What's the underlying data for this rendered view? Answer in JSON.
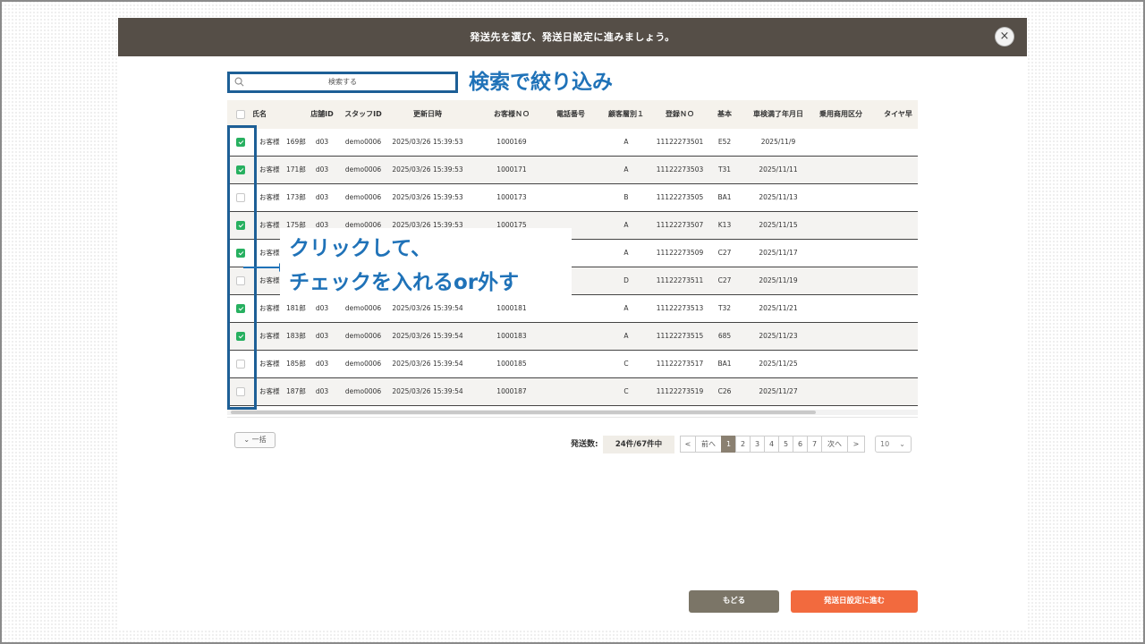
{
  "modal": {
    "title": "発送先を選び、発送日設定に進みましょう。",
    "close_icon": "×"
  },
  "search": {
    "placeholder": "検索する"
  },
  "annotations": {
    "search_note": "検索で絞り込み",
    "callout_line1": "クリックして、",
    "callout_line2": "チェックを入れるor外す"
  },
  "table": {
    "columns": [
      "氏名",
      "店舗ID",
      "スタッフID",
      "更新日時",
      "お客様ＮＯ",
      "電話番号",
      "顧客層別１",
      "登録ＮＯ",
      "基本",
      "車検満了年月日",
      "乗用商用区分",
      "タイヤ早"
    ],
    "rows": [
      {
        "checked": true,
        "name": "お客様　169郎",
        "store": "d03",
        "staff": "demo0006",
        "updated": "2025/03/26 15:39:53",
        "cust_no": "1000169",
        "phone": "",
        "segment": "A",
        "reg_no": "11122273501",
        "basic": "E52",
        "inspection": "2025/11/9"
      },
      {
        "checked": true,
        "name": "お客様　171郎",
        "store": "d03",
        "staff": "demo0006",
        "updated": "2025/03/26 15:39:53",
        "cust_no": "1000171",
        "phone": "",
        "segment": "A",
        "reg_no": "11122273503",
        "basic": "T31",
        "inspection": "2025/11/11"
      },
      {
        "checked": false,
        "name": "お客様　173郎",
        "store": "d03",
        "staff": "demo0006",
        "updated": "2025/03/26 15:39:53",
        "cust_no": "1000173",
        "phone": "",
        "segment": "B",
        "reg_no": "11122273505",
        "basic": "BA1",
        "inspection": "2025/11/13"
      },
      {
        "checked": true,
        "name": "お客様　175郎",
        "store": "d03",
        "staff": "demo0006",
        "updated": "2025/03/26 15:39:53",
        "cust_no": "1000175",
        "phone": "",
        "segment": "A",
        "reg_no": "11122273507",
        "basic": "K13",
        "inspection": "2025/11/15"
      },
      {
        "checked": true,
        "name": "お客様",
        "store": "",
        "staff": "",
        "updated": "",
        "cust_no": "",
        "phone": "",
        "segment": "A",
        "reg_no": "11122273509",
        "basic": "C27",
        "inspection": "2025/11/17"
      },
      {
        "checked": false,
        "name": "お客様",
        "store": "",
        "staff": "",
        "updated": "",
        "cust_no": "",
        "phone": "",
        "segment": "D",
        "reg_no": "11122273511",
        "basic": "C27",
        "inspection": "2025/11/19"
      },
      {
        "checked": true,
        "name": "お客様　181郎",
        "store": "d03",
        "staff": "demo0006",
        "updated": "2025/03/26 15:39:54",
        "cust_no": "1000181",
        "phone": "",
        "segment": "A",
        "reg_no": "11122273513",
        "basic": "T32",
        "inspection": "2025/11/21"
      },
      {
        "checked": true,
        "name": "お客様　183郎",
        "store": "d03",
        "staff": "demo0006",
        "updated": "2025/03/26 15:39:54",
        "cust_no": "1000183",
        "phone": "",
        "segment": "A",
        "reg_no": "11122273515",
        "basic": "685",
        "inspection": "2025/11/23"
      },
      {
        "checked": false,
        "name": "お客様　185郎",
        "store": "d03",
        "staff": "demo0006",
        "updated": "2025/03/26 15:39:54",
        "cust_no": "1000185",
        "phone": "",
        "segment": "C",
        "reg_no": "11122273517",
        "basic": "BA1",
        "inspection": "2025/11/25"
      },
      {
        "checked": false,
        "name": "お客様　187郎",
        "store": "d03",
        "staff": "demo0006",
        "updated": "2025/03/26 15:39:54",
        "cust_no": "1000187",
        "phone": "",
        "segment": "C",
        "reg_no": "11122273519",
        "basic": "C26",
        "inspection": "2025/11/27"
      }
    ]
  },
  "bulk_button": {
    "label": "一括",
    "icon": "chevron-down"
  },
  "summary": {
    "label": "発送数:",
    "value": "24件/67件中"
  },
  "pagination": {
    "first": "<",
    "prev": "前へ",
    "pages": [
      "1",
      "2",
      "3",
      "4",
      "5",
      "6",
      "7"
    ],
    "current": "1",
    "next": "次へ",
    "last": ">",
    "page_size": "10"
  },
  "footer": {
    "back_label": "もどる",
    "next_label": "発送日設定に進む"
  },
  "colors": {
    "header_bg": "#554e47",
    "accent_orange": "#f26a3e",
    "back_gray": "#7b7567",
    "check_green": "#27b060",
    "annotation_blue": "#1f72b8"
  }
}
